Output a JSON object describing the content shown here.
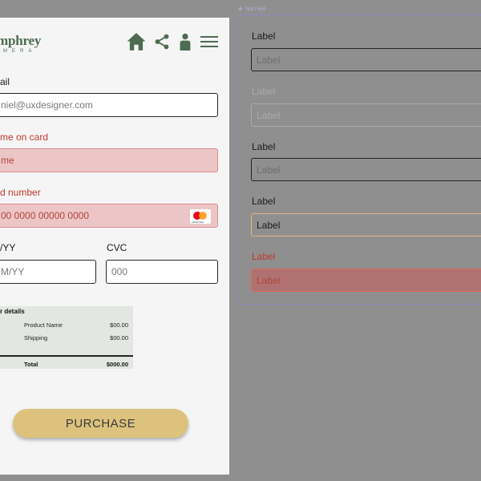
{
  "brand": {
    "name": "mphrey",
    "subname": "MERA"
  },
  "form": {
    "email": {
      "label": "ail",
      "value": "niel@uxdesigner.com"
    },
    "name_on_card": {
      "label": "me on card",
      "value": "me"
    },
    "card_number": {
      "label": "d number",
      "value": "00 0000 00000 0000",
      "card_brand_text": "mastercard"
    },
    "expiry": {
      "label": "/YY",
      "value": "M/YY"
    },
    "cvc": {
      "label": "CVC",
      "value": "000"
    }
  },
  "order": {
    "title": "r details",
    "items": [
      {
        "name": "Product Name",
        "amount": "$00.00"
      },
      {
        "name": "Shipping",
        "amount": "$00.00"
      }
    ],
    "total_label": "Total",
    "total_amount": "$000.00"
  },
  "purchase_label": "PURCHASE",
  "component": {
    "tag": "Text Field",
    "variants": [
      {
        "state": "default",
        "label": "Label",
        "value": "Label"
      },
      {
        "state": "disabled",
        "label": "Label",
        "value": "Label"
      },
      {
        "state": "filled",
        "label": "Label",
        "value": "Label"
      },
      {
        "state": "focus",
        "label": "Label",
        "value": "Label"
      },
      {
        "state": "error",
        "label": "Label",
        "value": "Label"
      }
    ]
  },
  "colors": {
    "brand_green": "#4d6b50",
    "button_gold": "#dcc27d",
    "error_red": "#c0392b",
    "error_fill": "#ecc6c6",
    "focus_orange": "#e3b48a",
    "frame_purple": "#8f85e8"
  },
  "icons": {
    "nav": [
      "home-icon",
      "share-icon",
      "user-icon",
      "menu-icon"
    ],
    "card": "mastercard-icon"
  }
}
